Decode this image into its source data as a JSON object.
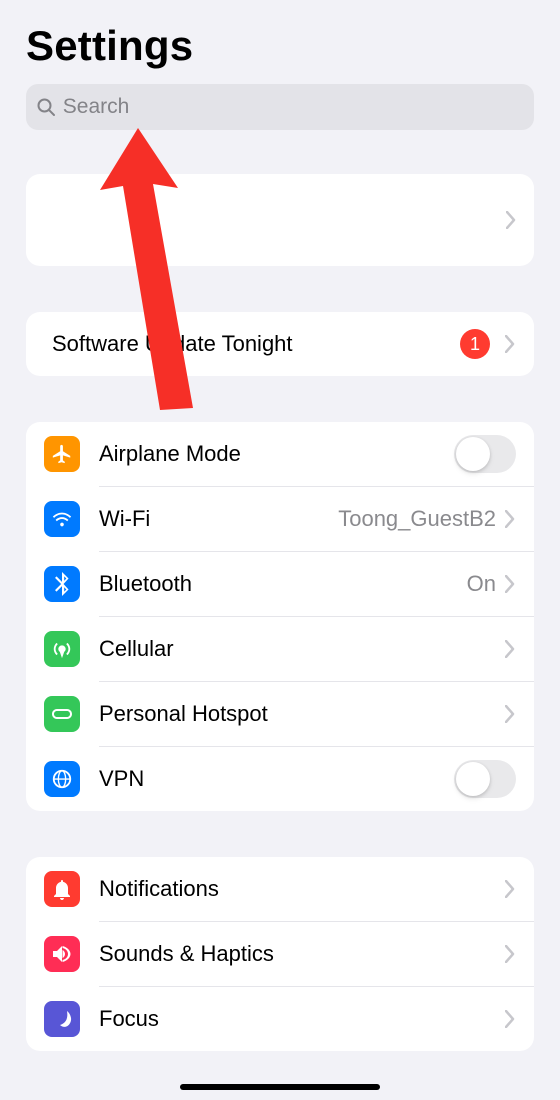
{
  "title": "Settings",
  "search": {
    "placeholder": "Search"
  },
  "software_update": {
    "label": "Software Update Tonight",
    "badge": "1"
  },
  "network": {
    "airplane": {
      "label": "Airplane Mode"
    },
    "wifi": {
      "label": "Wi-Fi",
      "detail": "Toong_GuestB2"
    },
    "bluetooth": {
      "label": "Bluetooth",
      "detail": "On"
    },
    "cellular": {
      "label": "Cellular"
    },
    "hotspot": {
      "label": "Personal Hotspot"
    },
    "vpn": {
      "label": "VPN"
    }
  },
  "notify": {
    "notifications": {
      "label": "Notifications"
    },
    "sounds": {
      "label": "Sounds & Haptics"
    },
    "focus": {
      "label": "Focus"
    }
  }
}
